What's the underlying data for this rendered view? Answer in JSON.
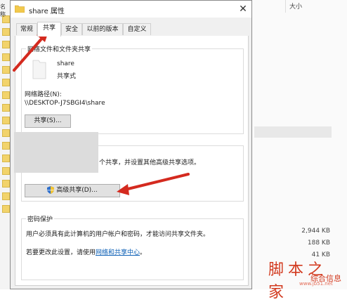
{
  "window_title": "share 属性",
  "tabs": [
    {
      "label": "常规"
    },
    {
      "label": "共享"
    },
    {
      "label": "安全"
    },
    {
      "label": "以前的版本"
    },
    {
      "label": "自定义"
    }
  ],
  "network_sharing": {
    "group_title": "网络文件和文件夹共享",
    "folder_name": "share",
    "folder_status": "共享式",
    "path_label": "网络路径(N):",
    "path_value": "\\\\DESKTOP-J7SBGI4\\share",
    "share_button": "共享(S)..."
  },
  "advanced_sharing": {
    "description": "个共享，并设置其他高级共享选项。",
    "button": "高级共享(D)..."
  },
  "password_protection": {
    "group_title": "密码保护",
    "text": "用户必须具有此计算机的用户帐户和密码，才能访问共享文件夹。",
    "change_prefix": "若要更改此设置，请使用",
    "link": "网络和共享中心",
    "change_suffix": "。"
  },
  "background": {
    "name_col_partial": "名称",
    "size_col_header": "大小",
    "file_sizes": [
      "2,944 KB",
      "188 KB",
      "41 KB"
    ]
  },
  "watermark": {
    "line1": "脚本之家",
    "line2": "综合信息",
    "line3": "www.jb51.net"
  },
  "colors": {
    "accent_arrow": "#d42a1f",
    "link": "#0a5eb5",
    "dialog_bg": "#f0f0f0"
  },
  "icons": {
    "folder": "folder-icon",
    "close": "close-icon",
    "shield": "uac-shield-icon"
  }
}
